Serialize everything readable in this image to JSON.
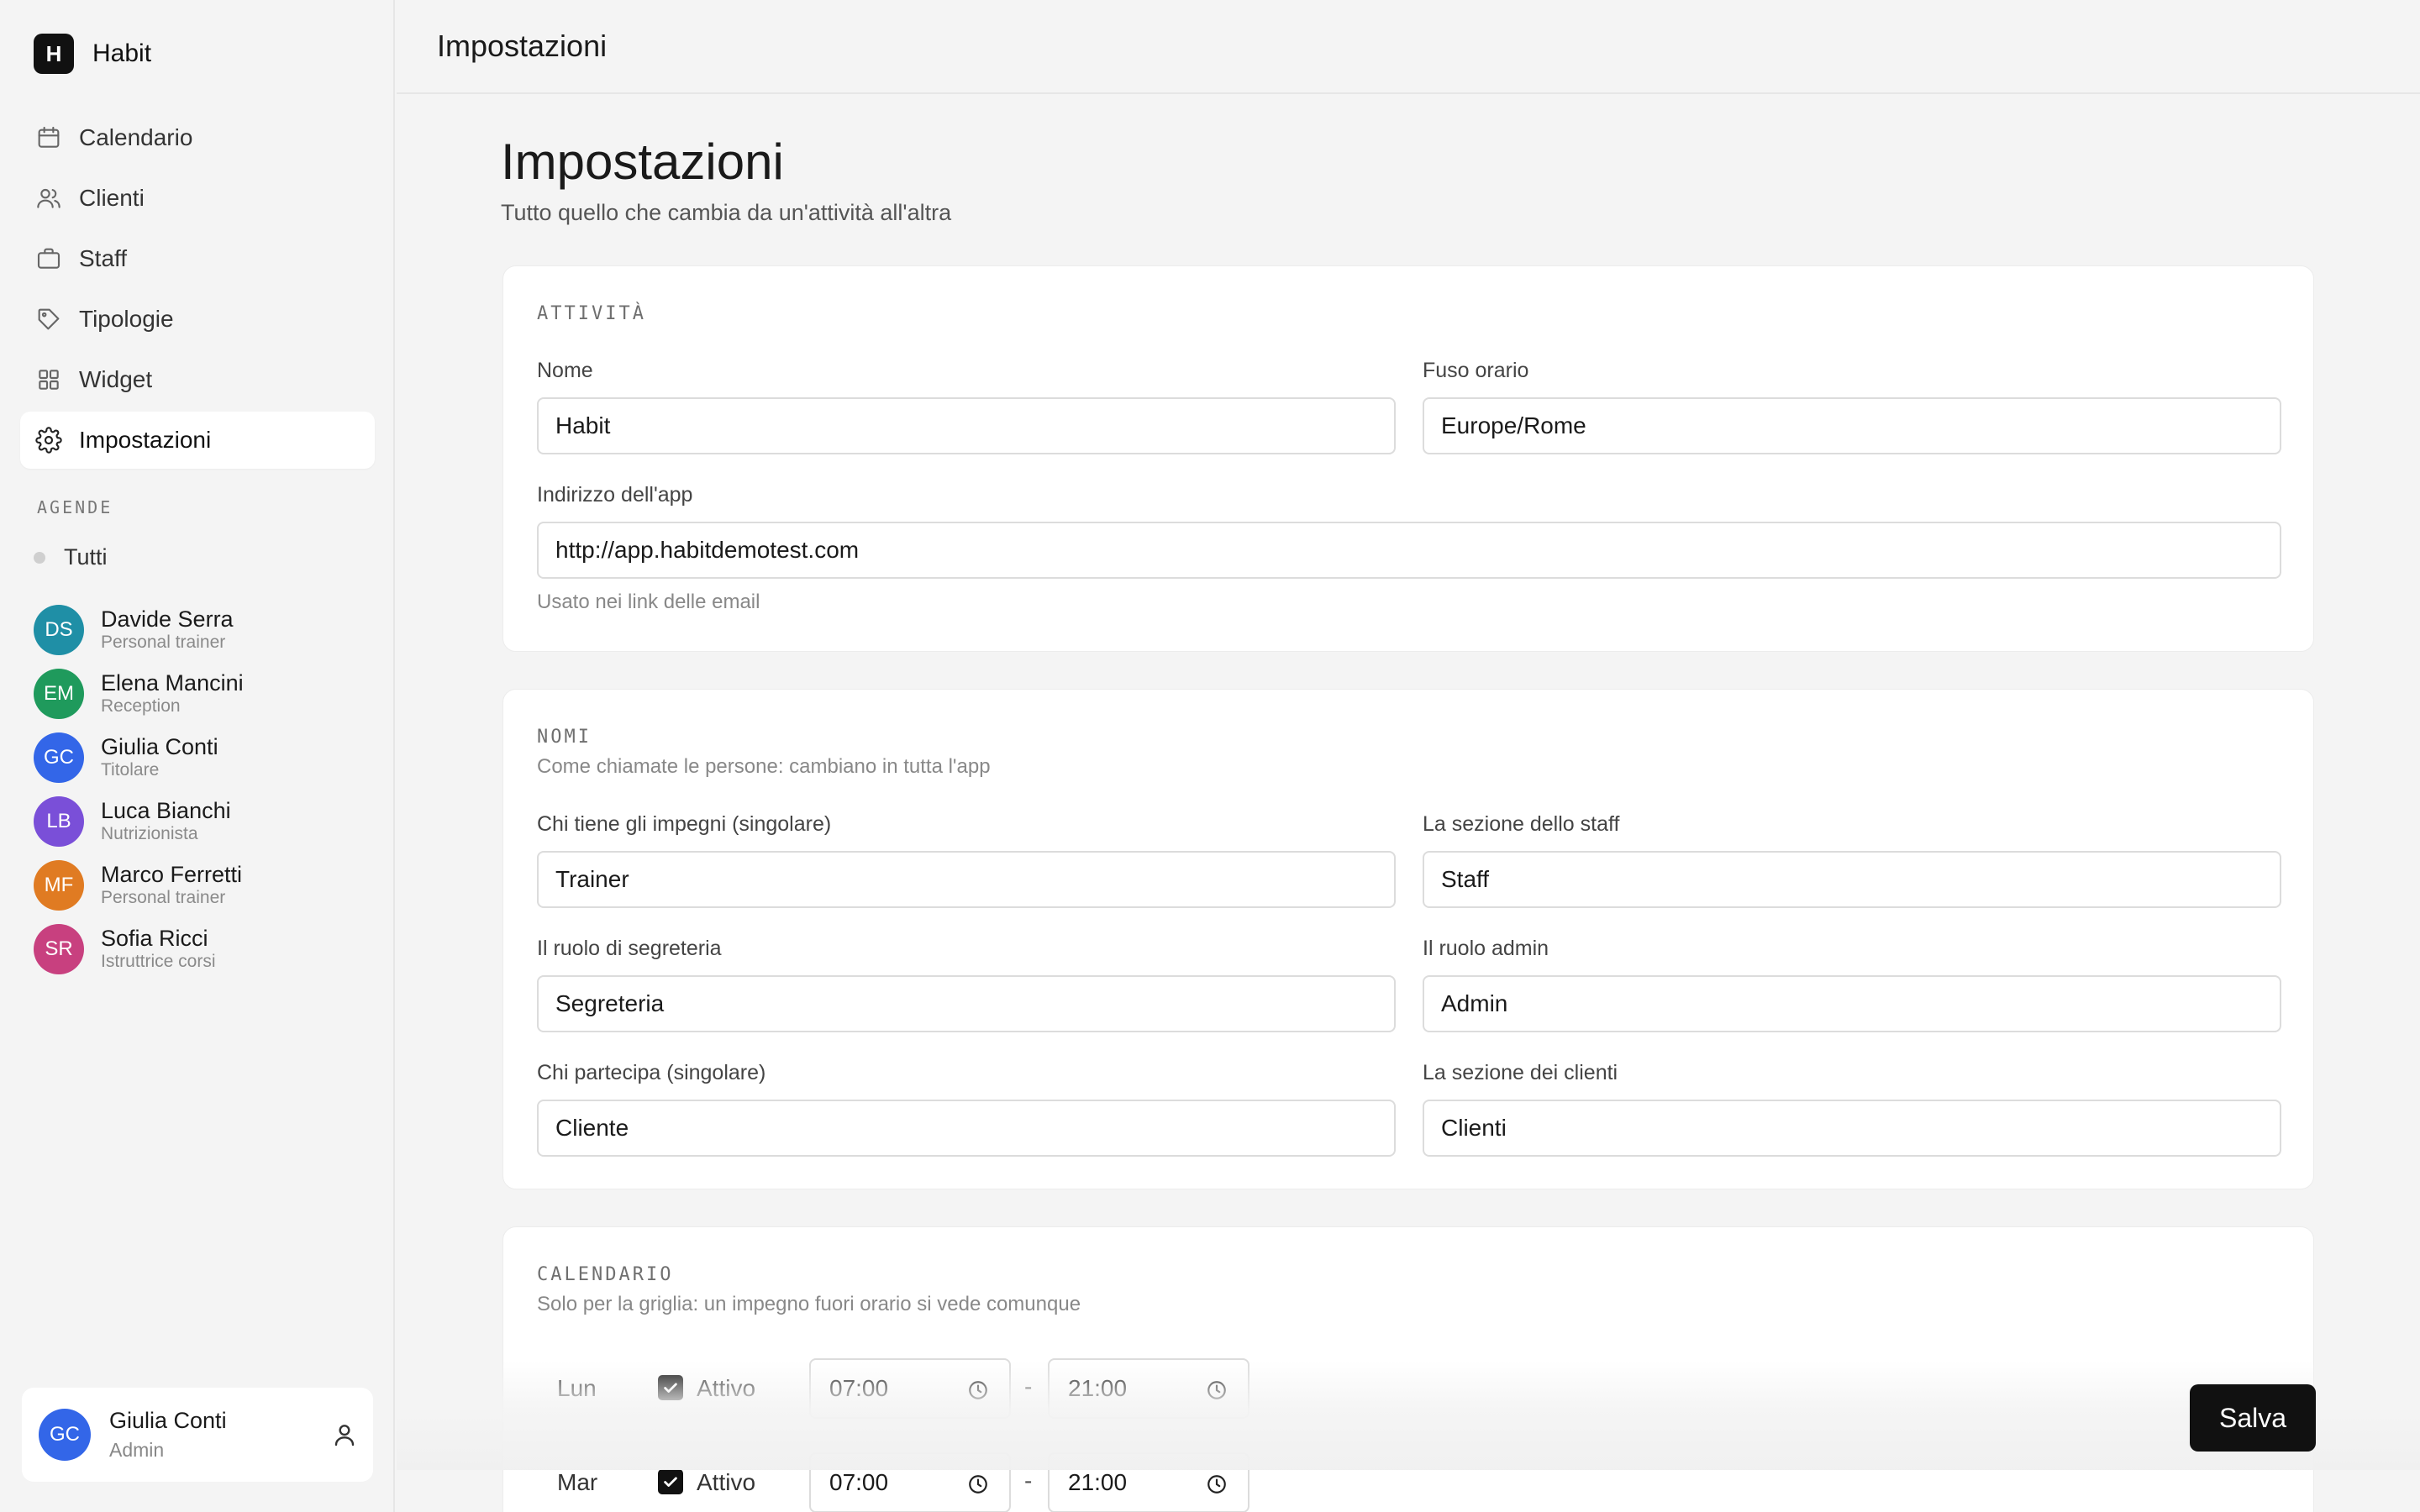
{
  "app": {
    "logo_letter": "H",
    "name": "Habit"
  },
  "nav": {
    "items": [
      {
        "label": "Calendario",
        "icon": "calendar-icon"
      },
      {
        "label": "Clienti",
        "icon": "users-icon"
      },
      {
        "label": "Staff",
        "icon": "briefcase-icon"
      },
      {
        "label": "Tipologie",
        "icon": "tag-icon"
      },
      {
        "label": "Widget",
        "icon": "grid-icon"
      },
      {
        "label": "Impostazioni",
        "icon": "gear-icon",
        "active": true
      }
    ]
  },
  "agende": {
    "label": "AGENDE",
    "all_label": "Tutti",
    "people": [
      {
        "initials": "DS",
        "name": "Davide Serra",
        "role": "Personal trainer",
        "color": "#1f8fa6"
      },
      {
        "initials": "EM",
        "name": "Elena Mancini",
        "role": "Reception",
        "color": "#1f9a5c"
      },
      {
        "initials": "GC",
        "name": "Giulia Conti",
        "role": "Titolare",
        "color": "#3366e8"
      },
      {
        "initials": "LB",
        "name": "Luca Bianchi",
        "role": "Nutrizionista",
        "color": "#7a4fd8"
      },
      {
        "initials": "MF",
        "name": "Marco Ferretti",
        "role": "Personal trainer",
        "color": "#e07b22"
      },
      {
        "initials": "SR",
        "name": "Sofia Ricci",
        "role": "Istruttrice corsi",
        "color": "#c8407f"
      }
    ]
  },
  "user": {
    "initials": "GC",
    "name": "Giulia Conti",
    "role": "Admin"
  },
  "topbar": {
    "title": "Impostazioni"
  },
  "page": {
    "title": "Impostazioni",
    "subtitle": "Tutto quello che cambia da un'attività all'altra"
  },
  "attivita": {
    "label": "ATTIVITÀ",
    "nome_label": "Nome",
    "nome_value": "Habit",
    "fuso_label": "Fuso orario",
    "fuso_value": "Europe/Rome",
    "indirizzo_label": "Indirizzo dell'app",
    "indirizzo_value": "http://app.habitdemotest.com",
    "indirizzo_hint": "Usato nei link delle email"
  },
  "nomi": {
    "label": "NOMI",
    "desc": "Come chiamate le persone: cambiano in tutta l'app",
    "fields": [
      {
        "label": "Chi tiene gli impegni (singolare)",
        "value": "Trainer"
      },
      {
        "label": "La sezione dello staff",
        "value": "Staff"
      },
      {
        "label": "Il ruolo di segreteria",
        "value": "Segreteria"
      },
      {
        "label": "Il ruolo admin",
        "value": "Admin"
      },
      {
        "label": "Chi partecipa (singolare)",
        "value": "Cliente"
      },
      {
        "label": "La sezione dei clienti",
        "value": "Clienti"
      }
    ]
  },
  "calendario": {
    "label": "CALENDARIO",
    "desc": "Solo per la griglia: un impegno fuori orario si vede comunque",
    "days": [
      {
        "day": "Lun",
        "active_label": "Attivo",
        "active": true,
        "from": "07:00",
        "to": "21:00"
      },
      {
        "day": "Mar",
        "active_label": "Attivo",
        "active": true,
        "from": "07:00",
        "to": "21:00"
      }
    ],
    "separator": "-"
  },
  "actions": {
    "save_label": "Salva"
  }
}
